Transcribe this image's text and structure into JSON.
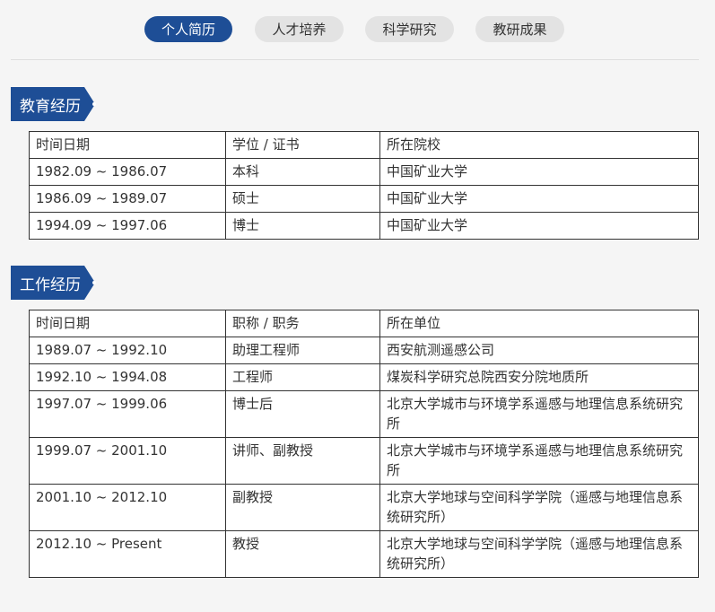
{
  "tabs": [
    {
      "label": "个人简历",
      "active": true
    },
    {
      "label": "人才培养",
      "active": false
    },
    {
      "label": "科学研究",
      "active": false
    },
    {
      "label": "教研成果",
      "active": false
    }
  ],
  "education": {
    "title": "教育经历",
    "headers": [
      "时间日期",
      "学位 / 证书",
      "所在院校"
    ],
    "rows": [
      [
        "1982.09 ~ 1986.07",
        "本科",
        "中国矿业大学"
      ],
      [
        "1986.09 ~ 1989.07",
        "硕士",
        "中国矿业大学"
      ],
      [
        "1994.09 ~ 1997.06",
        "博士",
        "中国矿业大学"
      ]
    ]
  },
  "work": {
    "title": "工作经历",
    "headers": [
      "时间日期",
      "职称 / 职务",
      "所在单位"
    ],
    "rows": [
      [
        "1989.07 ~ 1992.10",
        "助理工程师",
        "西安航测遥感公司"
      ],
      [
        "1992.10 ~ 1994.08",
        "工程师",
        "煤炭科学研究总院西安分院地质所"
      ],
      [
        "1997.07 ~ 1999.06",
        "博士后",
        "北京大学城市与环境学系遥感与地理信息系统研究所"
      ],
      [
        "1999.07 ~ 2001.10",
        "讲师、副教授",
        "北京大学城市与环境学系遥感与地理信息系统研究所"
      ],
      [
        "2001.10 ~ 2012.10",
        "副教授",
        "北京大学地球与空间科学学院（遥感与地理信息系统研究所）"
      ],
      [
        "2012.10 ~ Present",
        "教授",
        "北京大学地球与空间科学学院（遥感与地理信息系统研究所）"
      ]
    ]
  },
  "colors": {
    "accent": "#1e4e96",
    "tab_inactive": "#e3e3e3"
  }
}
